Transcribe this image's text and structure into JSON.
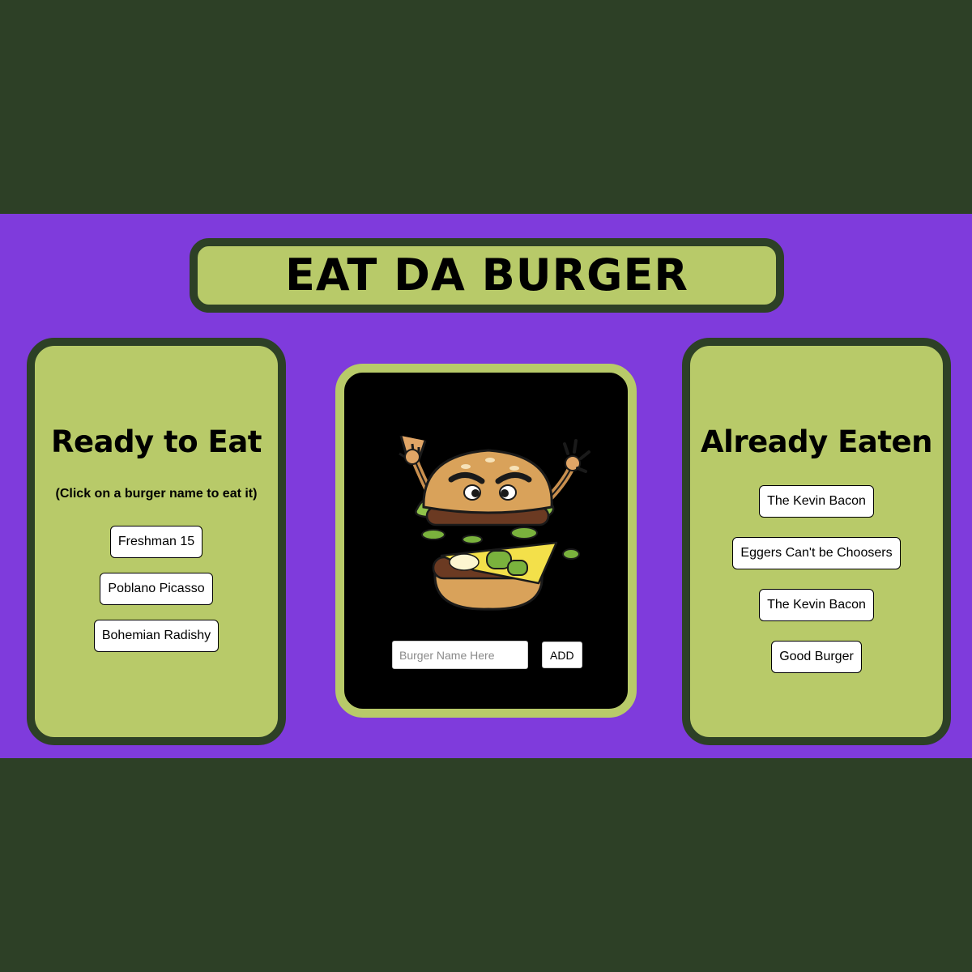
{
  "header": {
    "title": "EAT DA BURGER"
  },
  "ready_panel": {
    "heading": "Ready to Eat",
    "instruction": "(Click on a burger name to eat it)",
    "burgers": [
      "Freshman 15",
      "Poblano Picasso",
      "Bohemian Radishy"
    ]
  },
  "eaten_panel": {
    "heading": "Already Eaten",
    "burgers": [
      "The Kevin Bacon",
      "Eggers Can't be Choosers",
      "The Kevin Bacon",
      "Good Burger"
    ]
  },
  "add_form": {
    "placeholder": "Burger Name Here",
    "value": "",
    "add_label": "ADD"
  },
  "colors": {
    "background": "#2d4026",
    "band": "#7f3bdc",
    "panel": "#b8ca69",
    "card": "#000000"
  },
  "mascot_icon": "burger-mascot-icon"
}
